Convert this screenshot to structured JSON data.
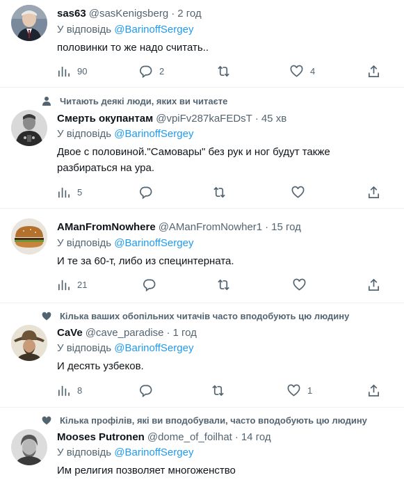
{
  "reply_prefix": "У відповідь",
  "tweets": [
    {
      "social_context": "",
      "name": "sas63",
      "handle": "@sasKenigsberg",
      "dot": "·",
      "time": "2 год",
      "mention": "@BarinoffSergey",
      "text": "половинки то же надо считать..",
      "views": "90",
      "replies": "2",
      "retweets": "",
      "likes": "4"
    },
    {
      "social_context": "Читають деякі люди, яких ви читаєте",
      "name": "Смерть окупантам",
      "handle": "@vpiFv287kaFEDsT",
      "dot": "·",
      "time": "45 хв",
      "mention": "@BarinoffSergey",
      "text": "Двое с половиной.\"Самовары\" без рук и ног будут также разбираться на ура.",
      "views": "5",
      "replies": "",
      "retweets": "",
      "likes": ""
    },
    {
      "social_context": "",
      "name": "AManFromNowhere",
      "handle": "@AManFromNowher1",
      "dot": "·",
      "time": "15 год",
      "mention": "@BarinoffSergey",
      "text": "И те за 60-т, либо из специнтерната.",
      "views": "21",
      "replies": "",
      "retweets": "",
      "likes": ""
    },
    {
      "social_context": "Кілька ваших обопільних читачів часто вподобують цю людину",
      "name": "CaVe",
      "handle": "@cave_paradise",
      "dot": "·",
      "time": "1 год",
      "mention": "@BarinoffSergey",
      "text": "И десять узбеков.",
      "views": "8",
      "replies": "",
      "retweets": "",
      "likes": "1"
    },
    {
      "social_context": "Кілька профілів, які ви вподобували, часто вподобують цю людину",
      "name": "Mooses Putronen",
      "handle": "@dome_of_foilhat",
      "dot": "·",
      "time": "14 год",
      "mention": "@BarinoffSergey",
      "text": "Им религия позволяет многоженство",
      "views": "",
      "replies": "",
      "retweets": "",
      "likes": ""
    }
  ]
}
